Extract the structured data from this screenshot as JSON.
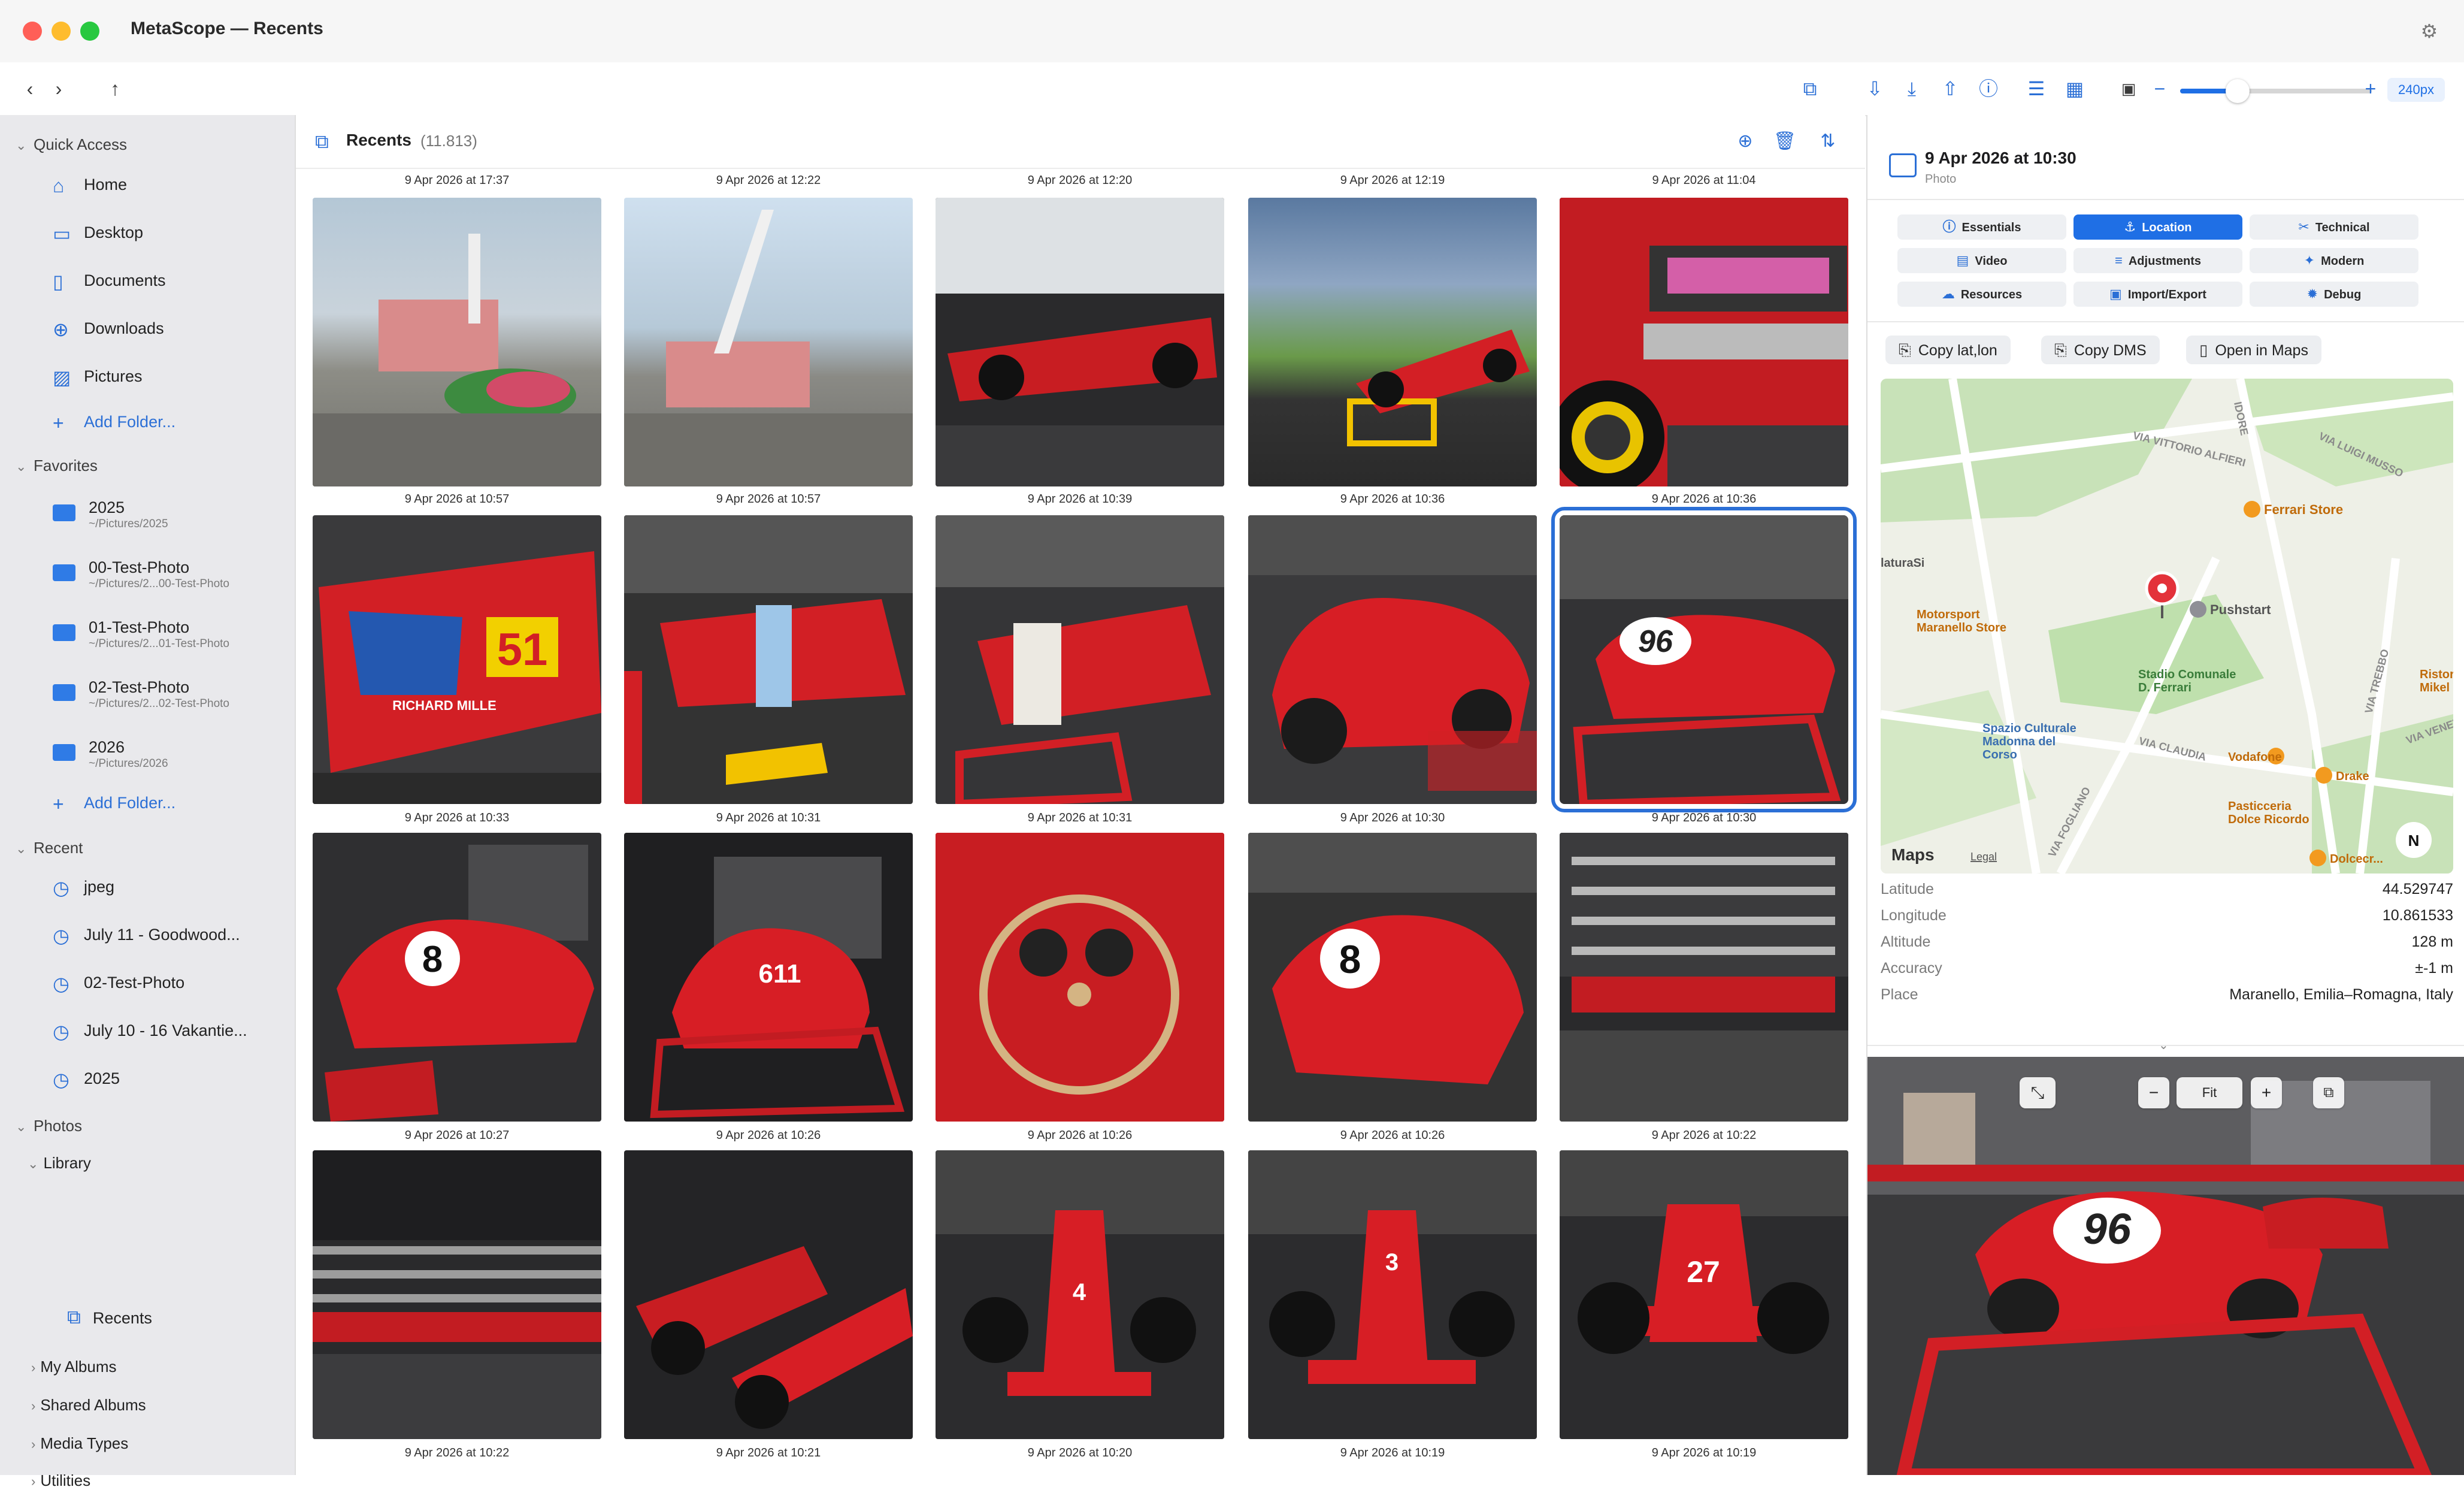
{
  "window": {
    "title": "MetaScope — Recents"
  },
  "toolbar": {
    "zoom_value": "240px",
    "zoom_level": 0.3
  },
  "sidebar": {
    "quick_access": {
      "label": "Quick Access",
      "items": [
        {
          "label": "Home",
          "icon": "house-icon"
        },
        {
          "label": "Desktop",
          "icon": "desktop-icon"
        },
        {
          "label": "Documents",
          "icon": "document-icon"
        },
        {
          "label": "Downloads",
          "icon": "download-icon"
        },
        {
          "label": "Pictures",
          "icon": "photo-icon"
        }
      ],
      "add": "Add Folder..."
    },
    "favorites": {
      "label": "Favorites",
      "items": [
        {
          "name": "2025",
          "path": "~/Pictures/2025"
        },
        {
          "name": "00-Test-Photo",
          "path": "~/Pictures/2...00-Test-Photo"
        },
        {
          "name": "01-Test-Photo",
          "path": "~/Pictures/2...01-Test-Photo"
        },
        {
          "name": "02-Test-Photo",
          "path": "~/Pictures/2...02-Test-Photo"
        },
        {
          "name": "2026",
          "path": "~/Pictures/2026"
        }
      ],
      "add": "Add Folder..."
    },
    "recent": {
      "label": "Recent",
      "items": [
        "jpeg",
        "July 11 - Goodwood...",
        "02-Test-Photo",
        "July 10 - 16 Vakantie...",
        "2025"
      ]
    },
    "photos": {
      "label": "Photos",
      "library": "Library",
      "recents": "Recents",
      "groups": [
        "My Albums",
        "Shared Albums",
        "Media Types",
        "Utilities"
      ]
    }
  },
  "main": {
    "title": "Recents",
    "count": "(11.813)",
    "top_captions": [
      "9 Apr 2026 at 17:37",
      "9 Apr 2026 at 12:22",
      "9 Apr 2026 at 12:20",
      "9 Apr 2026 at 12:19",
      "9 Apr 2026 at 11:04"
    ],
    "rows": [
      [
        "9 Apr 2026 at 10:57",
        "9 Apr 2026 at 10:57",
        "9 Apr 2026 at 10:39",
        "9 Apr 2026 at 10:36",
        "9 Apr 2026 at 10:36"
      ],
      [
        "9 Apr 2026 at 10:33",
        "9 Apr 2026 at 10:31",
        "9 Apr 2026 at 10:31",
        "9 Apr 2026 at 10:30",
        "9 Apr 2026 at 10:30"
      ],
      [
        "9 Apr 2026 at 10:27",
        "9 Apr 2026 at 10:26",
        "9 Apr 2026 at 10:26",
        "9 Apr 2026 at 10:26",
        "9 Apr 2026 at 10:22"
      ],
      [
        "9 Apr 2026 at 10:22",
        "9 Apr 2026 at 10:21",
        "9 Apr 2026 at 10:20",
        "9 Apr 2026 at 10:19",
        "9 Apr 2026 at 10:19"
      ]
    ],
    "photo_texts": {
      "car_61_number": "51",
      "car_61_sponsor": "RICHARD MILLE",
      "car_96": "96",
      "car_8": "8",
      "car_8b": "8",
      "car_611": "611",
      "f1_27": "27",
      "f1_4": "4",
      "f1_3": "3"
    },
    "selected_index": 9
  },
  "inspector": {
    "title": "9 Apr 2026 at 10:30",
    "subtitle": "Photo",
    "tabs": [
      {
        "label": "Essentials",
        "icon": "ⓘ",
        "active": false
      },
      {
        "label": "Location",
        "icon": "⚓",
        "active": true
      },
      {
        "label": "Technical",
        "icon": "✂",
        "active": false
      },
      {
        "label": "Video",
        "icon": "▤",
        "active": false
      },
      {
        "label": "Adjustments",
        "icon": "≡",
        "active": false
      },
      {
        "label": "Modern",
        "icon": "✦",
        "active": false
      },
      {
        "label": "Resources",
        "icon": "☁",
        "active": false
      },
      {
        "label": "Import/Export",
        "icon": "▣",
        "active": false
      },
      {
        "label": "Debug",
        "icon": "✹",
        "active": false
      }
    ],
    "actions": [
      {
        "label": "Copy lat,lon",
        "icon": "⎘"
      },
      {
        "label": "Copy DMS",
        "icon": "⎘"
      },
      {
        "label": "Open in Maps",
        "icon": "▯"
      }
    ],
    "map": {
      "streets": [
        "VIA VITTORIO ALFIERI",
        "VIA LUIGI MUSSO",
        "VIA CLAUDIA",
        "VIA TREBBO",
        "VIA VENETO",
        "VIA FOGLIANO",
        "IDORE"
      ],
      "places": [
        "Ferrari Store",
        "Pushstart",
        "Motorsport\nMaranello Store",
        "Stadio Comunale\nD. Ferrari",
        "Spazio Culturale\nMadonna del\nCorso",
        "Vodafone",
        "Drake",
        "Pasticceria\nDolce Ricordo",
        "Dolcecr...",
        "Ristor\nMikel",
        "laturaSi"
      ],
      "brand": "Maps",
      "legal": "Legal",
      "compass": "N"
    },
    "meta": [
      {
        "key": "Latitude",
        "value": "44.529747"
      },
      {
        "key": "Longitude",
        "value": "10.861533"
      },
      {
        "key": "Altitude",
        "value": "128 m"
      },
      {
        "key": "Accuracy",
        "value": "±-1 m"
      },
      {
        "key": "Place",
        "value": "Maranello, Emilia–Romagna, Italy"
      }
    ],
    "preview": {
      "fit_label": "Fit",
      "car_number": "96"
    }
  }
}
